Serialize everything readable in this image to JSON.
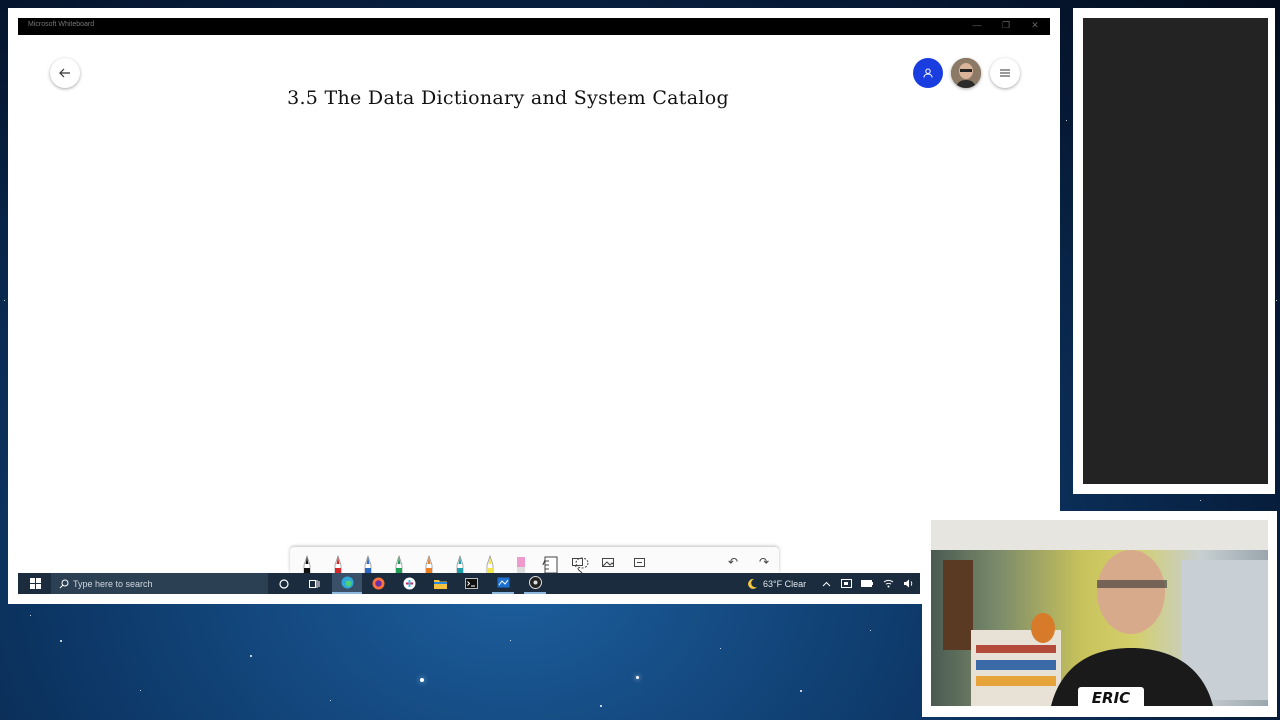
{
  "window": {
    "title": "Microsoft Whiteboard",
    "minimize_glyph": "—",
    "maximize_glyph": "❐",
    "close_glyph": "✕"
  },
  "board": {
    "title": "3.5 The Data Dictionary and System Catalog",
    "back_icon": "back-arrow-icon",
    "invite_icon": "invite-person-icon",
    "menu_icon": "hamburger-menu-icon"
  },
  "toolbar": {
    "tools": [
      {
        "name": "pen-black",
        "color": "#111111"
      },
      {
        "name": "pen-red",
        "color": "#d9262c"
      },
      {
        "name": "pen-blue",
        "color": "#2b68c8"
      },
      {
        "name": "pen-green",
        "color": "#1f9e55"
      },
      {
        "name": "pen-orange",
        "color": "#e97d22"
      },
      {
        "name": "pen-teal",
        "color": "#1f9eaa"
      },
      {
        "name": "highlighter-yellow",
        "color": "#f1e64a"
      },
      {
        "name": "eraser",
        "color": "#ef9acd"
      },
      {
        "name": "ruler",
        "color": "#555555"
      },
      {
        "name": "lasso",
        "color": "#555555"
      }
    ],
    "text_tool_glyph": "A",
    "undo_glyph": "↶",
    "redo_glyph": "↷"
  },
  "taskbar": {
    "search_placeholder": "Type here to search",
    "weather": "63°F  Clear"
  },
  "webcam": {
    "name_tag": "ERIC"
  }
}
